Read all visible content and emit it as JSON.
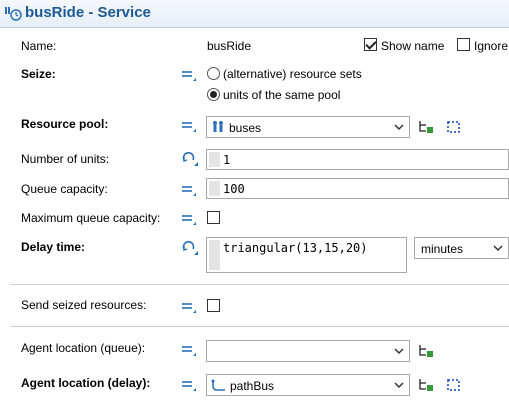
{
  "title": "busRide - Service",
  "colors": {
    "title": "#1e5a96",
    "accent_icon": "#2a6fb8",
    "green": "#3a9a3a",
    "select_blue": "#1040c0"
  },
  "icons": {
    "title": "service-block-icon",
    "equals": "static-value-icon",
    "function": "dynamic-value-icon",
    "pool": "resource-pool-icon",
    "path": "path-icon",
    "create": "create-new-icon",
    "select": "select-on-canvas-icon"
  },
  "name_row": {
    "label": "Name:",
    "value": "busRide",
    "show_name_label": "Show name",
    "ignore_label": "Ignore",
    "show_name_checked": true,
    "ignore_checked": false
  },
  "seize": {
    "label": "Seize:",
    "options": [
      {
        "label": "(alternative) resource sets",
        "selected": false
      },
      {
        "label": "units of the same pool",
        "selected": true
      }
    ]
  },
  "resource_pool": {
    "label": "Resource pool:",
    "value": "buses"
  },
  "number_of_units": {
    "label": "Number of units:",
    "value": "1"
  },
  "queue_capacity": {
    "label": "Queue capacity:",
    "value": "100"
  },
  "max_queue_capacity": {
    "label": "Maximum queue capacity:",
    "checked": false
  },
  "delay_time": {
    "label": "Delay time:",
    "value": "triangular(13,15,20)",
    "unit": "minutes"
  },
  "send_seized": {
    "label": "Send seized resources:",
    "checked": false
  },
  "agent_location_queue": {
    "label": "Agent location (queue):",
    "value": ""
  },
  "agent_location_delay": {
    "label": "Agent location (delay):",
    "value": "pathBus"
  }
}
